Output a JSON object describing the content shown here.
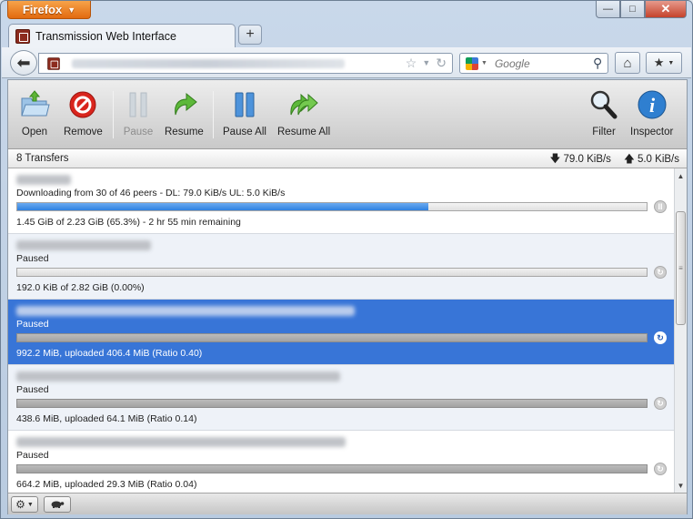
{
  "browser": {
    "menu_button": "Firefox",
    "tab_title": "Transmission Web Interface",
    "new_tab": "+",
    "search_placeholder": "Google",
    "window_controls": {
      "minimize": "—",
      "maximize": "□",
      "close": "✕"
    }
  },
  "toolbar": {
    "open": "Open",
    "remove": "Remove",
    "pause": "Pause",
    "resume": "Resume",
    "pause_all": "Pause All",
    "resume_all": "Resume All",
    "filter": "Filter",
    "inspector": "Inspector"
  },
  "status": {
    "transfers": "8 Transfers",
    "down_speed": "79.0 KiB/s",
    "up_speed": "5.0 KiB/s"
  },
  "torrents": [
    {
      "status": "Downloading from 30 of 46 peers - DL: 79.0 KiB/s UL: 5.0 KiB/s",
      "progress": "1.45 GiB of 2.23 GiB (65.3%) - 2 hr 55 min remaining",
      "percent": 65.3,
      "state": "downloading",
      "button": "pause"
    },
    {
      "status": "Paused",
      "progress": "192.0 KiB of 2.82 GiB (0.00%)",
      "percent": 0,
      "state": "paused-empty",
      "button": "resume"
    },
    {
      "status": "Paused",
      "progress": "992.2 MiB, uploaded 406.4 MiB (Ratio 0.40)",
      "percent": 100,
      "state": "paused",
      "button": "resume"
    },
    {
      "status": "Paused",
      "progress": "438.6 MiB, uploaded 64.1 MiB (Ratio 0.14)",
      "percent": 100,
      "state": "paused",
      "button": "resume"
    },
    {
      "status": "Paused",
      "progress": "664.2 MiB, uploaded 29.3 MiB (Ratio 0.04)",
      "percent": 100,
      "state": "paused",
      "button": "resume"
    }
  ],
  "colors": {
    "accent": "#3875d7",
    "progress": "#2f82e0",
    "remove": "#d9251d",
    "resume": "#4caa2c"
  }
}
